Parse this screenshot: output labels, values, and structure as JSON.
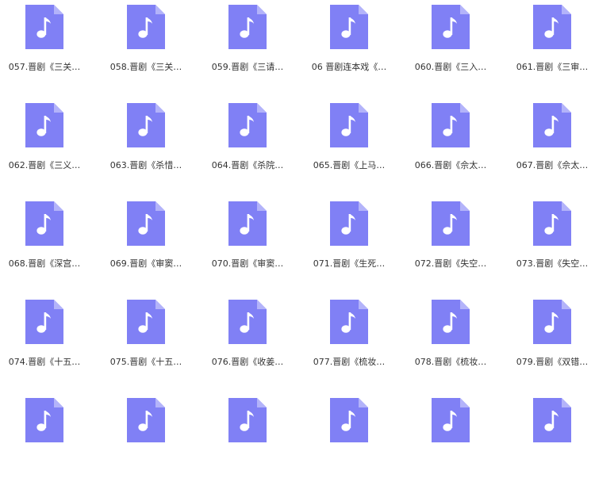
{
  "colors": {
    "icon_fill": "#8080F5",
    "icon_fold": "#B3B3FA",
    "note": "#FFFFFF",
    "label_text": "#333333"
  },
  "files": [
    {
      "name": "057.晋剧《三关…",
      "icon": "music-file-icon"
    },
    {
      "name": "058.晋剧《三关…",
      "icon": "music-file-icon"
    },
    {
      "name": "059.晋剧《三请…",
      "icon": "music-file-icon"
    },
    {
      "name": "06 晋剧连本戏《…",
      "icon": "music-file-icon"
    },
    {
      "name": "060.晋剧《三入…",
      "icon": "music-file-icon"
    },
    {
      "name": "061.晋剧《三审…",
      "icon": "music-file-icon"
    },
    {
      "name": "062.晋剧《三义…",
      "icon": "music-file-icon"
    },
    {
      "name": "063.晋剧《杀惜…",
      "icon": "music-file-icon"
    },
    {
      "name": "064.晋剧《杀院…",
      "icon": "music-file-icon"
    },
    {
      "name": "065.晋剧《上马…",
      "icon": "music-file-icon"
    },
    {
      "name": "066.晋剧《佘太…",
      "icon": "music-file-icon"
    },
    {
      "name": "067.晋剧《佘太…",
      "icon": "music-file-icon"
    },
    {
      "name": "068.晋剧《深宫…",
      "icon": "music-file-icon"
    },
    {
      "name": "069.晋剧《审窦…",
      "icon": "music-file-icon"
    },
    {
      "name": "070.晋剧《审窦…",
      "icon": "music-file-icon"
    },
    {
      "name": "071.晋剧《生死…",
      "icon": "music-file-icon"
    },
    {
      "name": "072.晋剧《失空…",
      "icon": "music-file-icon"
    },
    {
      "name": "073.晋剧《失空…",
      "icon": "music-file-icon"
    },
    {
      "name": "074.晋剧《十五…",
      "icon": "music-file-icon"
    },
    {
      "name": "075.晋剧《十五…",
      "icon": "music-file-icon"
    },
    {
      "name": "076.晋剧《收姜…",
      "icon": "music-file-icon"
    },
    {
      "name": "077.晋剧《梳妆…",
      "icon": "music-file-icon"
    },
    {
      "name": "078.晋剧《梳妆…",
      "icon": "music-file-icon"
    },
    {
      "name": "079.晋剧《双错…",
      "icon": "music-file-icon"
    },
    {
      "name": "",
      "icon": "music-file-icon"
    },
    {
      "name": "",
      "icon": "music-file-icon"
    },
    {
      "name": "",
      "icon": "music-file-icon"
    },
    {
      "name": "",
      "icon": "music-file-icon"
    },
    {
      "name": "",
      "icon": "music-file-icon"
    },
    {
      "name": "",
      "icon": "music-file-icon"
    }
  ]
}
